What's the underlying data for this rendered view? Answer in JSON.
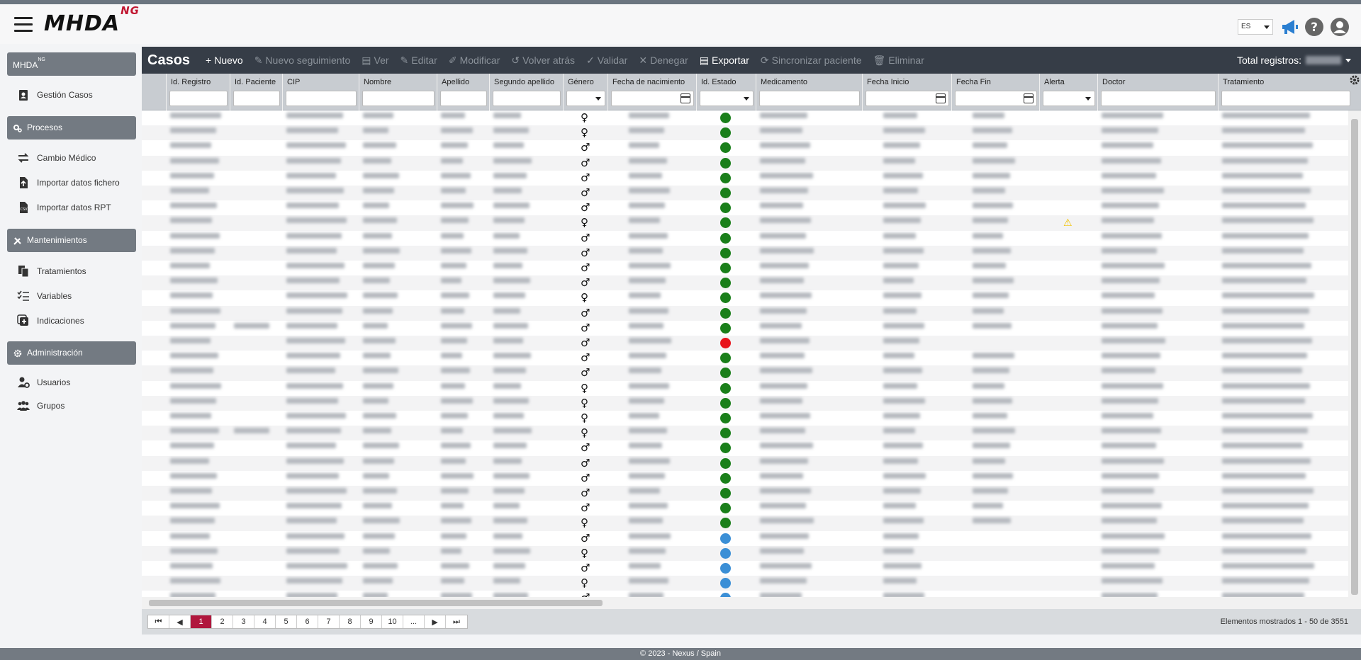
{
  "app": {
    "logo_text": "MHDA",
    "logo_sup": "NG",
    "language": "ES",
    "footer": "© 2023 - Nexus / Spain",
    "accent_color": "#b0173d"
  },
  "sidebar": {
    "sections": [
      {
        "label": "MHDA",
        "sup": "NG",
        "items": [
          {
            "label": "Gestión Casos",
            "icon": "clipboard-user-icon"
          }
        ]
      },
      {
        "label": "Procesos",
        "icon": "cogs-icon",
        "items": [
          {
            "label": "Cambio Médico",
            "icon": "exchange-icon"
          },
          {
            "label": "Importar datos fichero",
            "icon": "file-upload-icon"
          },
          {
            "label": "Importar datos RPT",
            "icon": "file-csv-icon"
          }
        ]
      },
      {
        "label": "Mantenimientos",
        "icon": "tools-icon",
        "items": [
          {
            "label": "Tratamientos",
            "icon": "copy-icon"
          },
          {
            "label": "Variables",
            "icon": "tasks-icon"
          },
          {
            "label": "Indicaciones",
            "icon": "plus-square-icon"
          }
        ]
      },
      {
        "label": "Administración",
        "icon": "cog-icon",
        "items": [
          {
            "label": "Usuarios",
            "icon": "user-cog-icon"
          },
          {
            "label": "Grupos",
            "icon": "users-icon"
          }
        ]
      }
    ]
  },
  "toolbar": {
    "title": "Casos",
    "buttons": [
      {
        "label": "Nuevo",
        "enabled": true,
        "icon": "plus-icon"
      },
      {
        "label": "Nuevo seguimiento",
        "enabled": false,
        "icon": "edit-icon"
      },
      {
        "label": "Ver",
        "enabled": false,
        "icon": "file-icon"
      },
      {
        "label": "Editar",
        "enabled": false,
        "icon": "edit-icon"
      },
      {
        "label": "Modificar",
        "enabled": false,
        "icon": "pen-icon"
      },
      {
        "label": "Volver atrás",
        "enabled": false,
        "icon": "undo-icon"
      },
      {
        "label": "Validar",
        "enabled": false,
        "icon": "check-icon"
      },
      {
        "label": "Denegar",
        "enabled": false,
        "icon": "times-icon"
      },
      {
        "label": "Exportar",
        "enabled": true,
        "icon": "file-export-icon"
      },
      {
        "label": "Sincronizar paciente",
        "enabled": false,
        "icon": "sync-icon"
      },
      {
        "label": "Eliminar",
        "enabled": false,
        "icon": "trash-icon"
      }
    ],
    "total_label": "Total registros:"
  },
  "grid": {
    "columns": [
      {
        "label": "Id. Registro",
        "filter": "text"
      },
      {
        "label": "Id. Paciente",
        "filter": "text"
      },
      {
        "label": "CIP",
        "filter": "text"
      },
      {
        "label": "Nombre",
        "filter": "text"
      },
      {
        "label": "Apellido",
        "filter": "text"
      },
      {
        "label": "Segundo apellido",
        "filter": "text"
      },
      {
        "label": "Género",
        "filter": "select"
      },
      {
        "label": "Fecha de nacimiento",
        "filter": "date"
      },
      {
        "label": "Id. Estado",
        "filter": "select"
      },
      {
        "label": "Medicamento",
        "filter": "text"
      },
      {
        "label": "Fecha Inicio",
        "filter": "date"
      },
      {
        "label": "Fecha Fin",
        "filter": "date"
      },
      {
        "label": "Alerta",
        "filter": "select"
      },
      {
        "label": "Doctor",
        "filter": "text"
      },
      {
        "label": "Tratamiento",
        "filter": "text"
      }
    ],
    "status_colors": {
      "green": "#1a7f1a",
      "red": "#e8141b",
      "blue": "#3b8fd6"
    },
    "rows": [
      {
        "gender": "♀",
        "status": "green",
        "fin": true,
        "alert": false
      },
      {
        "gender": "♀",
        "status": "green",
        "fin": true,
        "alert": false
      },
      {
        "gender": "♂",
        "status": "green",
        "fin": true,
        "alert": false
      },
      {
        "gender": "♂",
        "status": "green",
        "fin": true,
        "alert": false
      },
      {
        "gender": "♂",
        "status": "green",
        "fin": true,
        "alert": false
      },
      {
        "gender": "♂",
        "status": "green",
        "fin": true,
        "alert": false
      },
      {
        "gender": "♂",
        "status": "green",
        "fin": true,
        "alert": false
      },
      {
        "gender": "♀",
        "status": "green",
        "fin": true,
        "alert": true
      },
      {
        "gender": "♂",
        "status": "green",
        "fin": true,
        "alert": false
      },
      {
        "gender": "♂",
        "status": "green",
        "fin": true,
        "alert": false
      },
      {
        "gender": "♂",
        "status": "green",
        "fin": true,
        "alert": false
      },
      {
        "gender": "♂",
        "status": "green",
        "fin": true,
        "alert": false
      },
      {
        "gender": "♀",
        "status": "green",
        "fin": true,
        "alert": false
      },
      {
        "gender": "♂",
        "status": "green",
        "fin": true,
        "alert": false
      },
      {
        "gender": "♂",
        "status": "green",
        "fin": true,
        "alert": false
      },
      {
        "gender": "♂",
        "status": "red",
        "fin": false,
        "alert": false
      },
      {
        "gender": "♂",
        "status": "green",
        "fin": true,
        "alert": false
      },
      {
        "gender": "♂",
        "status": "green",
        "fin": true,
        "alert": false
      },
      {
        "gender": "♀",
        "status": "green",
        "fin": true,
        "alert": false
      },
      {
        "gender": "♀",
        "status": "green",
        "fin": true,
        "alert": false
      },
      {
        "gender": "♀",
        "status": "green",
        "fin": true,
        "alert": false
      },
      {
        "gender": "♀",
        "status": "green",
        "fin": true,
        "alert": false
      },
      {
        "gender": "♂",
        "status": "green",
        "fin": true,
        "alert": false
      },
      {
        "gender": "♂",
        "status": "green",
        "fin": true,
        "alert": false
      },
      {
        "gender": "♂",
        "status": "green",
        "fin": true,
        "alert": false
      },
      {
        "gender": "♂",
        "status": "green",
        "fin": true,
        "alert": false
      },
      {
        "gender": "♂",
        "status": "green",
        "fin": true,
        "alert": false
      },
      {
        "gender": "♀",
        "status": "green",
        "fin": true,
        "alert": false
      },
      {
        "gender": "♂",
        "status": "blue",
        "fin": false,
        "alert": false
      },
      {
        "gender": "♀",
        "status": "blue",
        "fin": false,
        "alert": false
      },
      {
        "gender": "♂",
        "status": "blue",
        "fin": false,
        "alert": false
      },
      {
        "gender": "♀",
        "status": "blue",
        "fin": false,
        "alert": false
      },
      {
        "gender": "♂",
        "status": "blue",
        "fin": false,
        "alert": false
      }
    ]
  },
  "pager": {
    "first": "⏮",
    "prev": "◀",
    "pages": [
      "1",
      "2",
      "3",
      "4",
      "5",
      "6",
      "7",
      "8",
      "9",
      "10",
      "..."
    ],
    "active": "1",
    "next": "▶",
    "last": "⏭",
    "info": "Elementos mostrados 1 - 50 de 3551"
  }
}
